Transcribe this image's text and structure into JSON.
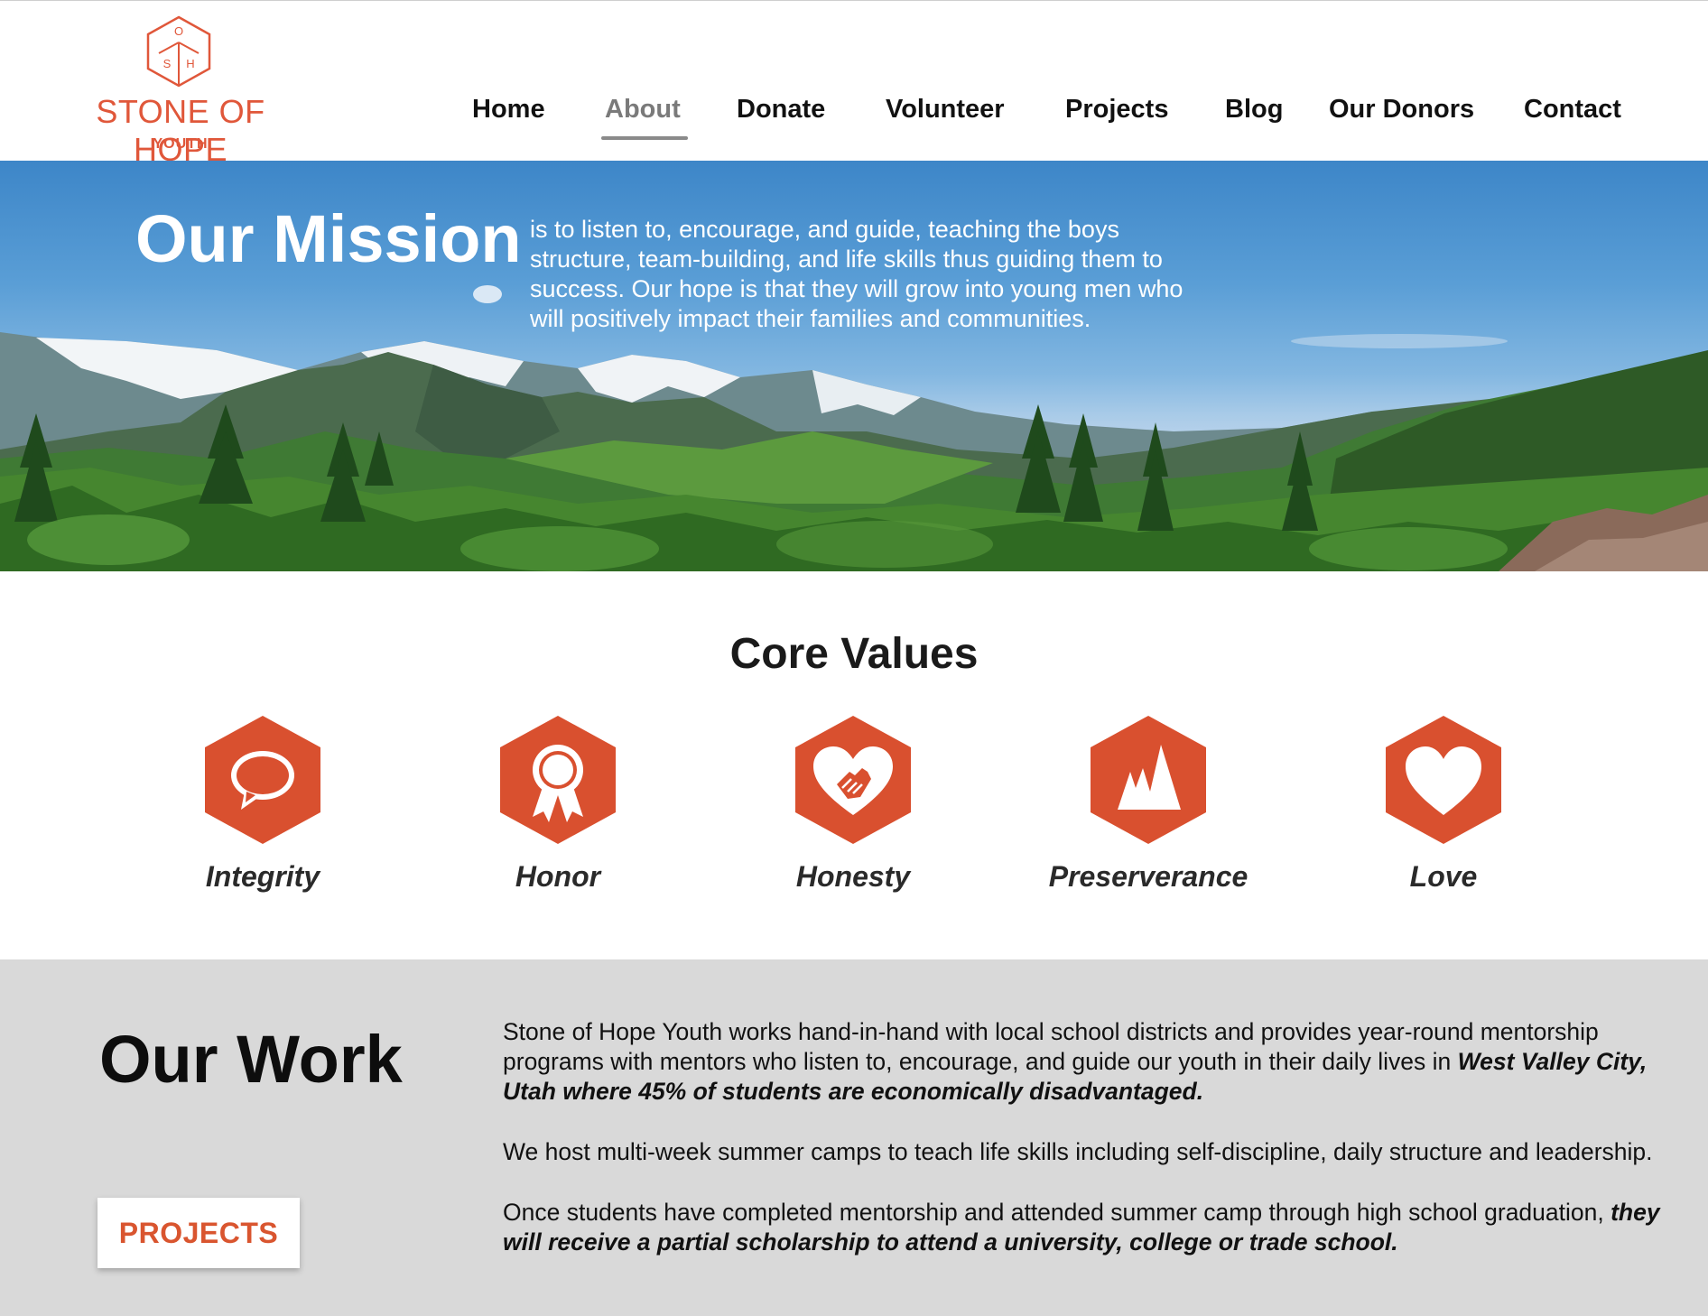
{
  "brand": {
    "logo_letters": [
      "O",
      "S",
      "H"
    ],
    "name": "STONE OF HOPE",
    "sub": "YOUTH",
    "accent_color": "#e0573a"
  },
  "nav": {
    "items": [
      "Home",
      "About",
      "Donate",
      "Volunteer",
      "Projects",
      "Blog",
      "Our Donors",
      "Contact"
    ],
    "active": "About"
  },
  "hero": {
    "title": "Our Mission",
    "text": "is to listen to, encourage, and guide, teaching the boys structure, team-building, and life skills thus guiding them to success. Our hope is that they will grow into young men who will positively impact their families and communities."
  },
  "core_values": {
    "title": "Core Values",
    "items": [
      {
        "label": "Integrity",
        "icon": "speech-bubble-icon"
      },
      {
        "label": "Honor",
        "icon": "award-ribbon-icon"
      },
      {
        "label": "Honesty",
        "icon": "heart-hand-icon"
      },
      {
        "label": "Preserverance",
        "icon": "mountain-peaks-icon"
      },
      {
        "label": "Love",
        "icon": "heart-icon"
      }
    ]
  },
  "work": {
    "title": "Our Work",
    "button": "PROJECTS",
    "p1_plain": "Stone of Hope Youth works hand-in-hand with local school districts and provides year-round mentorship programs with mentors who listen to, encourage, and guide our youth in their daily lives in ",
    "p1_bold": "West Valley City, Utah where 45% of students are economically disadvantaged.",
    "p2": "We host multi-week summer camps to teach life skills including self-discipline, daily structure and leadership.",
    "p3_plain": "Once students have completed mentorship and attended summer camp through high school graduation, ",
    "p3_bold": "they will receive a partial scholarship to attend a university, college or trade school."
  }
}
